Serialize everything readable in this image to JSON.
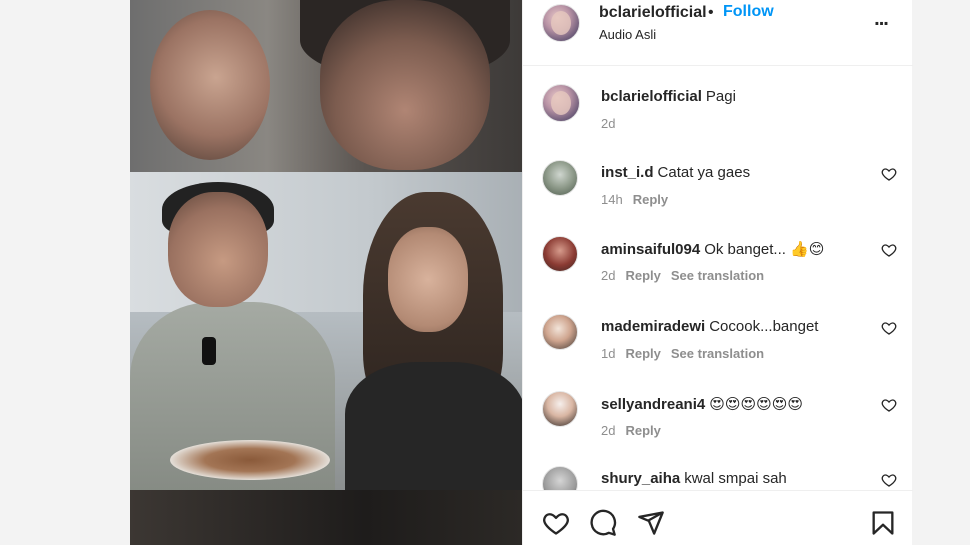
{
  "post": {
    "username": "bclarielofficial",
    "separator": "•",
    "follow_label": "Follow",
    "audio": "Audio Asli",
    "more": "..."
  },
  "caption": {
    "username": "bclarielofficial",
    "text": "Pagi",
    "time": "2d"
  },
  "comments": [
    {
      "username": "inst_i.d",
      "text": "Catat ya gaes",
      "time": "14h",
      "reply": "Reply",
      "translate": "",
      "avatar": "house"
    },
    {
      "username": "aminsaiful094",
      "text": "Ok banget... 👍😊",
      "time": "2d",
      "reply": "Reply",
      "translate": "See translation",
      "avatar": "man"
    },
    {
      "username": "mademiradewi",
      "text": "Cocook...banget",
      "time": "1d",
      "reply": "Reply",
      "translate": "See translation",
      "avatar": "woman"
    },
    {
      "username": "sellyandreani4",
      "text": "😍😍😍😍😍😍",
      "time": "2d",
      "reply": "Reply",
      "translate": "",
      "avatar": "girl"
    },
    {
      "username": "shury_aiha",
      "text": "kwal smpai sah",
      "time": "",
      "reply": "",
      "translate": "",
      "avatar": "grey"
    }
  ],
  "icons": {
    "like": "heart-outline-icon",
    "comment": "speech-bubble-icon",
    "share": "paper-plane-icon",
    "save": "bookmark-icon",
    "comment_like": "small-heart-icon",
    "more": "more-options-icon"
  },
  "colors": {
    "follow": "#0095f6",
    "text": "#262626",
    "secondary": "#8e8e8e",
    "border": "#efefef"
  }
}
